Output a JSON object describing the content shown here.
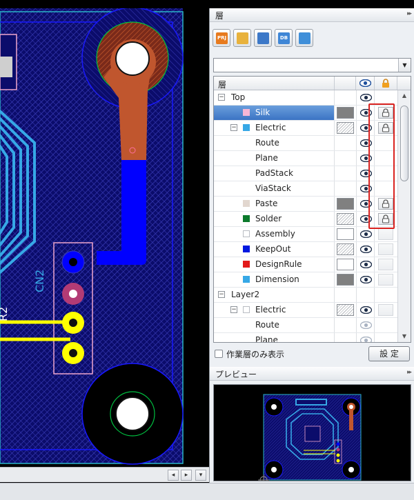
{
  "layer_panel": {
    "title": "層",
    "collapse_glyph": "▸▸",
    "toolbar": [
      {
        "name": "project-tool",
        "text": "PRJ",
        "color": "#e77a1e"
      },
      {
        "name": "book-tool",
        "text": "",
        "color": "#e8b23c"
      },
      {
        "name": "layers-tool",
        "text": "",
        "color": "#3c78c8"
      },
      {
        "name": "db-tool",
        "text": "DB",
        "color": "#3e86d6"
      },
      {
        "name": "grid-tool",
        "text": "",
        "color": "#3f8fd9"
      }
    ],
    "filter_value": "",
    "grid_header": {
      "layer_label": "層",
      "eye_icon": "eye-icon",
      "lock_icon": "lock-icon"
    },
    "rows": [
      {
        "label": "Top",
        "level": 0,
        "expander": "−",
        "swatch": null,
        "color_box": null,
        "eye": "visible",
        "lock": "none"
      },
      {
        "label": "Silk",
        "level": 1,
        "expander": null,
        "swatch": "#f6b6d6",
        "color_box": "gray",
        "eye": "visible",
        "lock": "locked",
        "selected": true
      },
      {
        "label": "Electric",
        "level": 1,
        "expander": "−",
        "swatch": "#36a8e6",
        "color_box": "hatch",
        "eye": "visible",
        "lock": "locked"
      },
      {
        "label": "Route",
        "level": 2,
        "expander": null,
        "swatch": null,
        "color_box": null,
        "eye": "visible",
        "lock": "none"
      },
      {
        "label": "Plane",
        "level": 2,
        "expander": null,
        "swatch": null,
        "color_box": null,
        "eye": "visible",
        "lock": "none"
      },
      {
        "label": "PadStack",
        "level": 2,
        "expander": null,
        "swatch": null,
        "color_box": null,
        "eye": "visible",
        "lock": "none"
      },
      {
        "label": "ViaStack",
        "level": 2,
        "expander": null,
        "swatch": null,
        "color_box": null,
        "eye": "visible",
        "lock": "none"
      },
      {
        "label": "Paste",
        "level": 1,
        "expander": null,
        "swatch": "#e2d7cf",
        "color_box": "gray",
        "eye": "visible",
        "lock": "locked"
      },
      {
        "label": "Solder",
        "level": 1,
        "expander": null,
        "swatch": "#0c7a2c",
        "color_box": "hatch",
        "eye": "visible",
        "lock": "locked"
      },
      {
        "label": "Assembly",
        "level": 1,
        "expander": null,
        "swatch": "#ffffff",
        "color_box": "white",
        "eye": "visible",
        "lock": "empty"
      },
      {
        "label": "KeepOut",
        "level": 1,
        "expander": null,
        "swatch": "#0018e0",
        "color_box": "hatch",
        "eye": "visible",
        "lock": "empty"
      },
      {
        "label": "DesignRule",
        "level": 1,
        "expander": null,
        "swatch": "#e21a1a",
        "color_box": "white",
        "eye": "visible",
        "lock": "empty"
      },
      {
        "label": "Dimension",
        "level": 1,
        "expander": null,
        "swatch": "#36a8e6",
        "color_box": "gray",
        "eye": "visible",
        "lock": "empty"
      },
      {
        "label": "Layer2",
        "level": 0,
        "expander": "−",
        "swatch": null,
        "color_box": null,
        "eye": "none",
        "lock": "none"
      },
      {
        "label": "Electric",
        "level": 1,
        "expander": "−",
        "swatch": "#ffffff",
        "color_box": "hatch",
        "eye": "visible",
        "lock": "empty"
      },
      {
        "label": "Route",
        "level": 2,
        "expander": null,
        "swatch": null,
        "color_box": null,
        "eye": "dim",
        "lock": "none"
      },
      {
        "label": "Plane",
        "level": 2,
        "expander": null,
        "swatch": null,
        "color_box": null,
        "eye": "dim",
        "lock": "none"
      }
    ],
    "only_work_layer_label": "作業層のみ表示",
    "only_work_layer_checked": false,
    "settings_button": "設 定"
  },
  "preview_panel": {
    "title": "プレビュー",
    "collapse_glyph": "▸▸"
  },
  "canvas": {
    "reference_designator": "CN2",
    "partial_label": "R2",
    "colors": {
      "board": "#0b0c6b",
      "hatch": "#2e31a8",
      "copper_top": "#b9532e",
      "blue_trace": "#0000ff",
      "yellow_trace": "#ffff00",
      "silk": "#f0a6cc",
      "pad_hatch": "#36a8e6"
    }
  },
  "canvas_scroll": {
    "left": "◂",
    "right": "▸",
    "down": "▾"
  }
}
